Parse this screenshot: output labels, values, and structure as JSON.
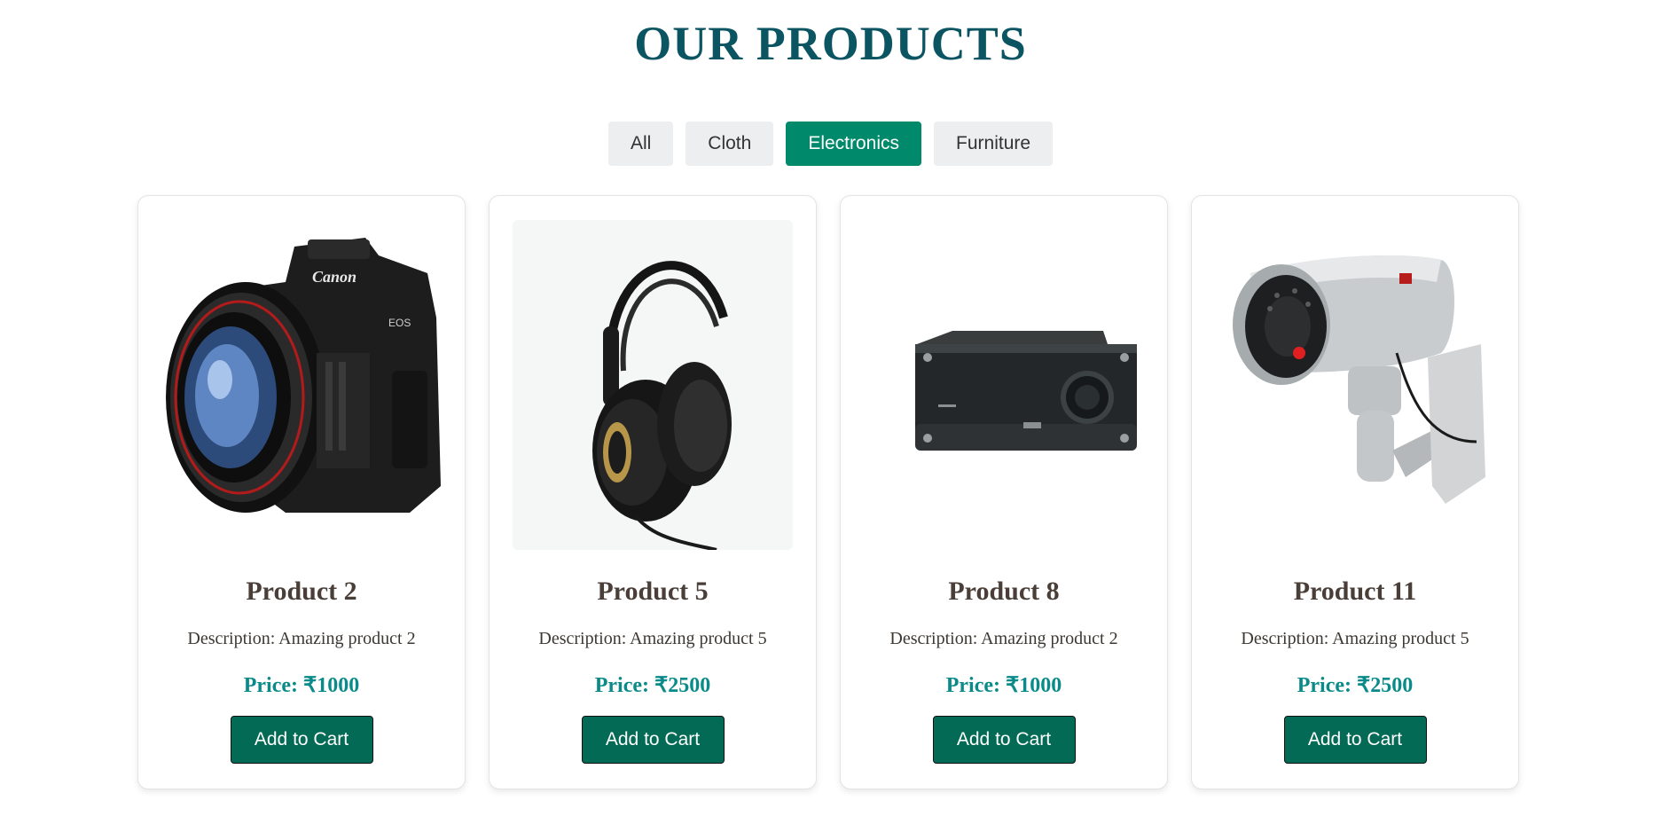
{
  "page": {
    "title": "OUR PRODUCTS"
  },
  "filters": [
    {
      "label": "All",
      "active": false
    },
    {
      "label": "Cloth",
      "active": false
    },
    {
      "label": "Electronics",
      "active": true
    },
    {
      "label": "Furniture",
      "active": false
    }
  ],
  "products": [
    {
      "name": "Product 2",
      "description": "Description: Amazing product 2",
      "price": "Price: ₹1000",
      "button": "Add to Cart",
      "image": "camera"
    },
    {
      "name": "Product 5",
      "description": "Description: Amazing product 5",
      "price": "Price: ₹2500",
      "button": "Add to Cart",
      "image": "headphones"
    },
    {
      "name": "Product 8",
      "description": "Description: Amazing product 2",
      "price": "Price: ₹1000",
      "button": "Add to Cart",
      "image": "amplifier"
    },
    {
      "name": "Product 11",
      "description": "Description: Amazing product 5",
      "price": "Price: ₹2500",
      "button": "Add to Cart",
      "image": "security-camera"
    }
  ],
  "colors": {
    "title": "#0b5563",
    "active_filter": "#00896a",
    "price": "#0b8a8a",
    "cart_button": "#036a55"
  }
}
